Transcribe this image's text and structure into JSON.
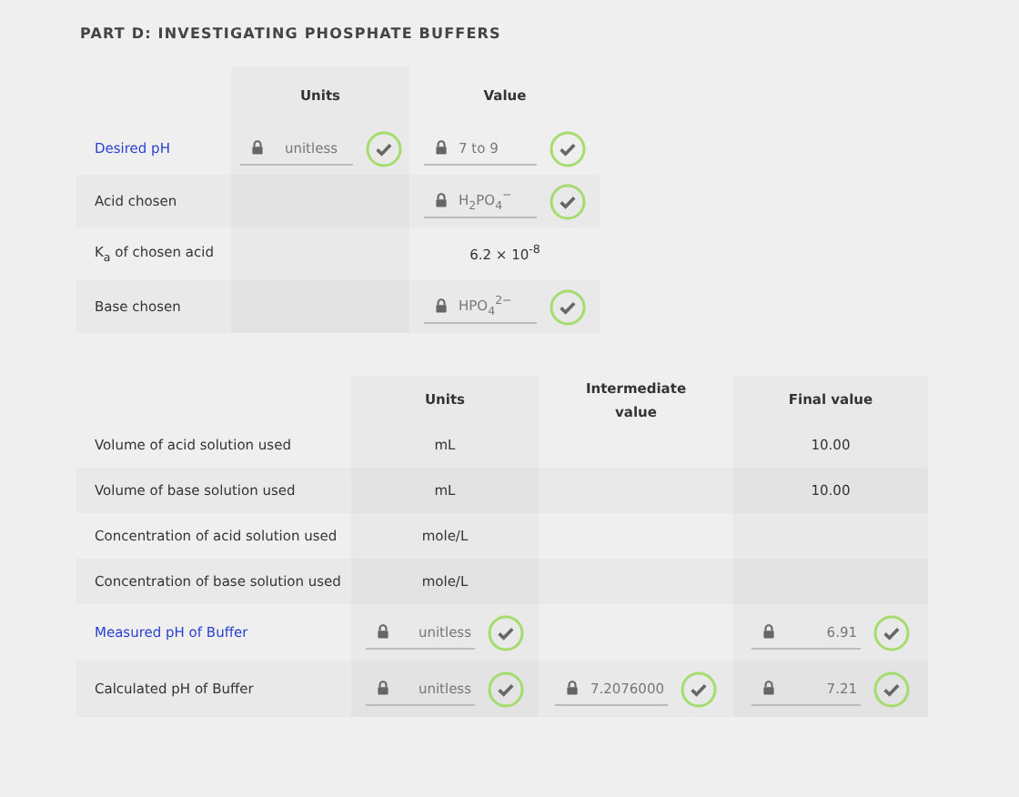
{
  "title": "PART D: INVESTIGATING PHOSPHATE BUFFERS",
  "table1": {
    "columns": [
      "Units",
      "Value"
    ],
    "rows": [
      {
        "label": "Desired pH",
        "linked": true,
        "units": {
          "kind": "field",
          "value": "unitless",
          "locked": true,
          "correct": true
        },
        "value": {
          "kind": "field",
          "value": "7 to 9",
          "locked": true,
          "correct": true
        }
      },
      {
        "label": "Acid chosen",
        "linked": false,
        "value": {
          "kind": "field",
          "value": "H$_{2}$PO$_{4}$$^{−}$",
          "locked": true,
          "correct": true
        }
      },
      {
        "label": "K$_{a}$ of chosen acid",
        "linked": false,
        "value": {
          "kind": "text",
          "value": "6.2 × 10$^{-8}$"
        }
      },
      {
        "label": "Base chosen",
        "linked": false,
        "value": {
          "kind": "field",
          "value": "HPO$_{4}$$^{2−}$",
          "locked": true,
          "correct": true
        }
      }
    ]
  },
  "table2": {
    "columns": [
      "Units",
      "Intermediate value",
      "Final value"
    ],
    "rows": [
      {
        "label": "Volume of acid solution used",
        "linked": false,
        "units": {
          "kind": "text",
          "value": "mL"
        },
        "final": {
          "kind": "text",
          "value": "10.00"
        }
      },
      {
        "label": "Volume of base solution used",
        "linked": false,
        "units": {
          "kind": "text",
          "value": "mL"
        },
        "final": {
          "kind": "text",
          "value": "10.00"
        }
      },
      {
        "label": "Concentration of acid solution used",
        "linked": false,
        "units": {
          "kind": "text",
          "value": "mole/L"
        }
      },
      {
        "label": "Concentration of base solution used",
        "linked": false,
        "units": {
          "kind": "text",
          "value": "mole/L"
        }
      },
      {
        "label": "Measured pH of Buffer",
        "linked": true,
        "units": {
          "kind": "field",
          "value": "unitless",
          "locked": true,
          "correct": true
        },
        "final": {
          "kind": "field",
          "value": "6.91",
          "locked": true,
          "correct": true
        }
      },
      {
        "label": "Calculated pH of Buffer",
        "linked": false,
        "units": {
          "kind": "field",
          "value": "unitless",
          "locked": true,
          "correct": true
        },
        "intermediate": {
          "kind": "field",
          "value": "7.2076000",
          "locked": true,
          "correct": true
        },
        "final": {
          "kind": "field",
          "value": "7.21",
          "locked": true,
          "correct": true
        }
      }
    ]
  }
}
